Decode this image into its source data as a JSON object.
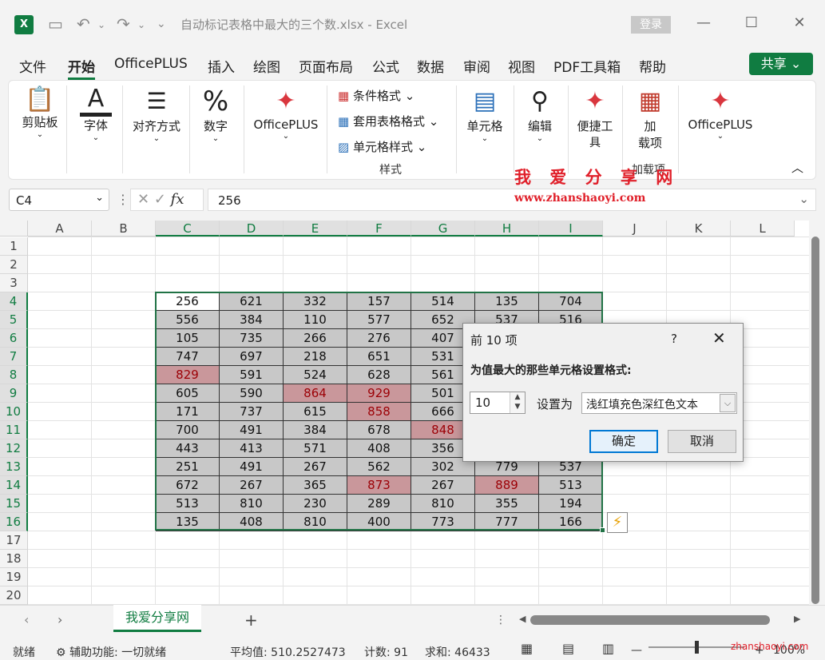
{
  "title_bar": {
    "app_icon": "excel-icon",
    "doc_title": "自动标记表格中最大的三个数.xlsx  -  Excel",
    "login": "登录"
  },
  "menu": [
    "文件",
    "开始",
    "OfficePLUS",
    "插入",
    "绘图",
    "页面布局",
    "公式",
    "数据",
    "审阅",
    "视图",
    "PDF工具箱",
    "帮助"
  ],
  "share": "共享",
  "ribbon": {
    "clipboard": "剪贴板",
    "font": "字体",
    "align": "对齐方式",
    "number": "数字",
    "officeplus1": "OfficePLUS",
    "cond_format": "条件格式",
    "table_format": "套用表格格式",
    "cell_style": "单元格样式",
    "styles_group": "样式",
    "cells": "单元格",
    "edit": "编辑",
    "quick_tools_1": "便捷工",
    "quick_tools_2": "具",
    "addins_1": "加",
    "addins_2": "载项",
    "addins_group": "加载项",
    "officeplus2": "OfficePLUS"
  },
  "watermark": {
    "cn": "我 爱 分 享 网",
    "url": "www.zhanshaoyi.com"
  },
  "formula_bar": {
    "name_box": "C4",
    "formula": "256"
  },
  "columns": [
    "A",
    "B",
    "C",
    "D",
    "E",
    "F",
    "G",
    "H",
    "I",
    "J",
    "K",
    "L"
  ],
  "rows": [
    "1",
    "2",
    "3",
    "4",
    "5",
    "6",
    "7",
    "8",
    "9",
    "10",
    "11",
    "12",
    "13",
    "14",
    "15",
    "16",
    "17",
    "18",
    "19",
    "20"
  ],
  "table": [
    [
      "256",
      "621",
      "332",
      "157",
      "514",
      "135",
      "704"
    ],
    [
      "556",
      "384",
      "110",
      "577",
      "652",
      "537",
      "516"
    ],
    [
      "105",
      "735",
      "266",
      "276",
      "407",
      "",
      ""
    ],
    [
      "747",
      "697",
      "218",
      "651",
      "531",
      "",
      ""
    ],
    [
      "829",
      "591",
      "524",
      "628",
      "561",
      "",
      ""
    ],
    [
      "605",
      "590",
      "864",
      "929",
      "501",
      "",
      ""
    ],
    [
      "171",
      "737",
      "615",
      "858",
      "666",
      "",
      ""
    ],
    [
      "700",
      "491",
      "384",
      "678",
      "848",
      "",
      ""
    ],
    [
      "443",
      "413",
      "571",
      "408",
      "356",
      "",
      ""
    ],
    [
      "251",
      "491",
      "267",
      "562",
      "302",
      "779",
      "537"
    ],
    [
      "672",
      "267",
      "365",
      "873",
      "267",
      "889",
      "513"
    ],
    [
      "513",
      "810",
      "230",
      "289",
      "810",
      "355",
      "194"
    ],
    [
      "135",
      "408",
      "810",
      "400",
      "773",
      "777",
      "166"
    ]
  ],
  "highlighted": [
    "4,0",
    "5,2",
    "5,3",
    "6,3",
    "7,4",
    "10,3",
    "10,5"
  ],
  "dialog": {
    "title": "前 10 项",
    "help": "?",
    "instruction": "为值最大的那些单元格设置格式:",
    "count": "10",
    "set_as": "设置为",
    "format": "浅红填充色深红色文本",
    "ok": "确定",
    "cancel": "取消"
  },
  "sheet_tab": "我爱分享网",
  "status": {
    "ready": "就绪",
    "accessibility": "辅助功能: 一切就绪",
    "average": "平均值: 510.2527473",
    "count": "计数: 91",
    "sum": "求和: 46433",
    "zoom": "100%",
    "watermark": "zhanshaoyi.com"
  },
  "colors": {
    "accent": "#107c41",
    "highlight_fill": "#c9979b",
    "highlight_text": "#9c0006",
    "selected_fill": "#c8c8c8"
  }
}
